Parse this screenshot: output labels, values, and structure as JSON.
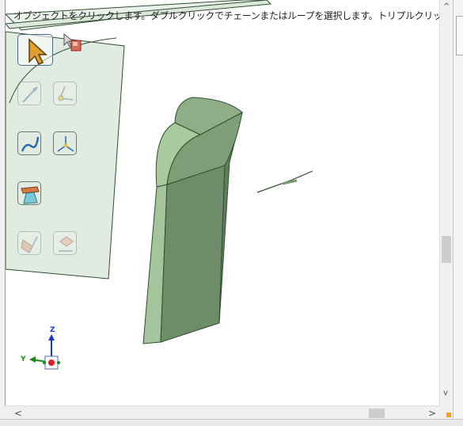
{
  "hint": {
    "text": "オブジェクトをクリックします。ダブルクリックでチェーンまたはループを選択します。トリプルクリックでソリッドを選"
  },
  "toolbar": {
    "buttons": [
      {
        "name": "select-pointer-button",
        "icon": "arrow-cursor-icon",
        "state": "active"
      },
      {
        "name": "select-face-button",
        "icon": "cursor-box-icon",
        "state": "enabled"
      },
      {
        "name": "select-edge-button",
        "icon": "line-pick-icon",
        "state": "disabled"
      },
      {
        "name": "select-vertex-button",
        "icon": "vertex-pick-icon",
        "state": "disabled"
      },
      {
        "name": "select-curve-button",
        "icon": "curve-pick-icon",
        "state": "enabled"
      },
      {
        "name": "select-point-button",
        "icon": "point-arrows-icon",
        "state": "enabled"
      },
      {
        "name": "select-body-button",
        "icon": "body-pick-icon",
        "state": "enabled"
      },
      {
        "name": "select-feature-button",
        "icon": "feature-pick-icon",
        "state": "disabled"
      },
      {
        "name": "select-sketch-button",
        "icon": "sketch-pick-icon",
        "state": "disabled"
      }
    ]
  },
  "triad": {
    "z_label": "Z",
    "y_label": "Y"
  },
  "colors": {
    "model_fill": "#6e8c68",
    "model_light": "#9fbf96",
    "panel_fill": "#dce8dc",
    "edge": "#2f4f2f",
    "axis_z": "#1a33c8",
    "axis_y": "#1a8a1a",
    "origin": "#e02020"
  }
}
